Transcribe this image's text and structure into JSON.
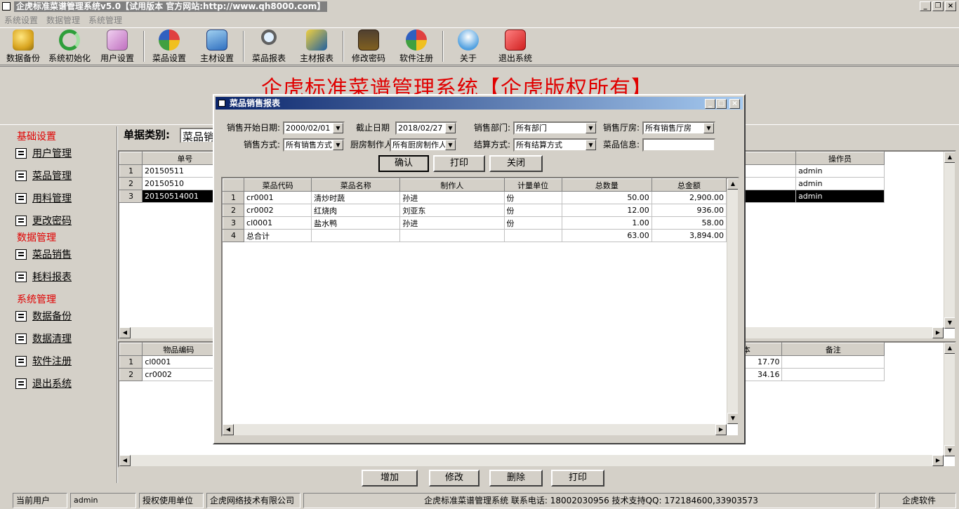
{
  "window": {
    "title": "企虎标准菜谱管理系统v5.0【试用版本 官方网站:http://www.qh8000.com】",
    "buttons": [
      "_",
      "❐",
      "×"
    ]
  },
  "menu": [
    "系统设置",
    "数据管理",
    "系统管理"
  ],
  "toolbar": [
    {
      "label": "数据备份",
      "icon": "database-backup-icon",
      "color": "#d9a520"
    },
    {
      "label": "系统初始化",
      "icon": "refresh-icon",
      "color": "#2e9e3a"
    },
    {
      "label": "用户设置",
      "icon": "user-settings-icon",
      "color": "#c070c0"
    },
    {
      "label": "菜品设置",
      "icon": "dish-settings-icon",
      "color": "#e04040"
    },
    {
      "label": "主材设置",
      "icon": "material-settings-icon",
      "color": "#3070c0"
    },
    {
      "label": "菜品报表",
      "icon": "search-report-icon",
      "color": "#a0a0a0"
    },
    {
      "label": "主材报表",
      "icon": "material-report-icon",
      "color": "#2060a0"
    },
    {
      "label": "修改密码",
      "icon": "key-icon",
      "color": "#806020"
    },
    {
      "label": "软件注册",
      "icon": "register-icon",
      "color": "#e04040"
    },
    {
      "label": "关于",
      "icon": "about-icon",
      "color": "#50a0e0"
    },
    {
      "label": "退出系统",
      "icon": "exit-icon",
      "color": "#d02020"
    }
  ],
  "banner": "企虎标准菜谱管理系统【企虎版权所有】",
  "nav": {
    "section1": "基础设置",
    "items1": [
      "用户管理",
      "菜品管理",
      "用料管理",
      "更改密码"
    ],
    "section2": "数据管理",
    "items2": [
      "菜品销售",
      "耗料报表"
    ],
    "section3": "系统管理",
    "items3": [
      "数据备份",
      "数据清理",
      "软件注册",
      "退出系统"
    ]
  },
  "main": {
    "bill_type_label": "单据类别:",
    "bill_type_value": "菜品销",
    "upper_grid": {
      "col_no": "单号",
      "col_operator": "操作员",
      "rows": [
        {
          "n": "1",
          "no": "20150511",
          "operator": "admin"
        },
        {
          "n": "2",
          "no": "20150510",
          "operator": "admin"
        },
        {
          "n": "3",
          "no": "20150514001",
          "operator": "admin"
        }
      ]
    },
    "lower_grid": {
      "col_code": "物品编码",
      "col_cost": "本",
      "col_note": "备注",
      "rows": [
        {
          "n": "1",
          "code": "cl0001",
          "cost": "17.70"
        },
        {
          "n": "2",
          "code": "cr0002",
          "cost": "34.16"
        }
      ]
    },
    "buttons": [
      "增加",
      "修改",
      "删除",
      "打印"
    ]
  },
  "status": {
    "cur_user_label": "当前用户",
    "cur_user": "admin",
    "licensee_label": "授权使用单位",
    "licensee": "企虎网络技术有限公司",
    "info": "企虎标准菜谱管理系统  联系电话: 18002030956  技术支持QQ: 172184600,33903573",
    "brand": "企虎软件"
  },
  "dialog": {
    "title": "菜品销售报表",
    "start_date_label": "销售开始日期:",
    "start_date": "2000/02/01",
    "end_date_label": "截止日期",
    "end_date": "2018/02/27",
    "dept_label": "销售部门:",
    "dept": "所有部门",
    "hall_label": "销售厅房:",
    "hall": "所有销售厅房",
    "method_label": "销售方式:",
    "method": "所有销售方式",
    "cook_label": "厨房制作人",
    "cook": "所有厨房制作人",
    "settle_label": "结算方式:",
    "settle": "所有结算方式",
    "dish_info_label": "菜品信息:",
    "dish_info": "",
    "btn_ok": "确认",
    "btn_print": "打印",
    "btn_close": "关闭",
    "columns": [
      "菜品代码",
      "菜品名称",
      "制作人",
      "计量单位",
      "总数量",
      "总金额"
    ],
    "rows": [
      {
        "n": "1",
        "code": "cr0001",
        "name": "清炒时蔬",
        "maker": "孙进",
        "unit": "份",
        "qty": "50.00",
        "amt": "2,900.00"
      },
      {
        "n": "2",
        "code": "cr0002",
        "name": "红烧肉",
        "maker": "刘亚东",
        "unit": "份",
        "qty": "12.00",
        "amt": "936.00"
      },
      {
        "n": "3",
        "code": "cl0001",
        "name": "盐水鸭",
        "maker": "孙进",
        "unit": "份",
        "qty": "1.00",
        "amt": "58.00"
      },
      {
        "n": "4",
        "code": "总合计",
        "name": "",
        "maker": "",
        "unit": "",
        "qty": "63.00",
        "amt": "3,894.00"
      }
    ]
  }
}
